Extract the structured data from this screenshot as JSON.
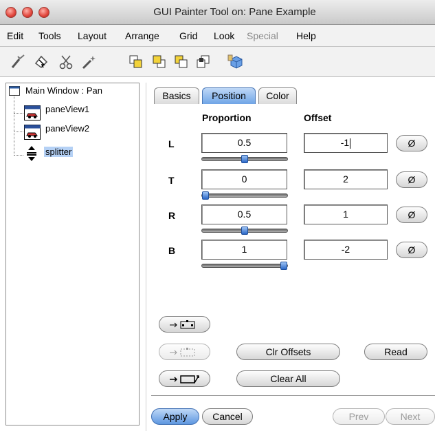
{
  "window": {
    "title": "GUI Painter Tool on: Pane Example"
  },
  "menubar": {
    "items": [
      {
        "label": "Edit",
        "enabled": true
      },
      {
        "label": "Tools",
        "enabled": true
      },
      {
        "label": "Layout",
        "enabled": true
      },
      {
        "label": "Arrange",
        "enabled": true
      },
      {
        "label": "Grid",
        "enabled": true
      },
      {
        "label": "Look",
        "enabled": true
      },
      {
        "label": "Special",
        "enabled": false
      },
      {
        "label": "Help",
        "enabled": true
      }
    ]
  },
  "toolbar": {
    "icons": [
      "wand-check-icon",
      "select-arrow-icon",
      "scissors-icon",
      "wand-icon",
      "bring-to-front-icon",
      "send-to-back-icon",
      "bring-forward-icon",
      "send-backward-icon",
      "cube-paint-icon"
    ]
  },
  "tree": {
    "root": "Main Window : Pan",
    "children": [
      {
        "label": "paneView1",
        "icon": "pane-view-icon"
      },
      {
        "label": "paneView2",
        "icon": "pane-view-icon"
      },
      {
        "label": "splitter",
        "icon": "splitter-icon",
        "selected": true
      }
    ]
  },
  "tabs": [
    {
      "label": "Basics",
      "active": false
    },
    {
      "label": "Position",
      "active": true
    },
    {
      "label": "Color",
      "active": false
    }
  ],
  "position": {
    "proportion_header": "Proportion",
    "offset_header": "Offset",
    "rows": [
      {
        "label": "L",
        "proportion": "0.5",
        "offset": "-1",
        "slider_fraction": 0.5,
        "zero_label": "Ø"
      },
      {
        "label": "T",
        "proportion": "0",
        "offset": "2",
        "slider_fraction": 0.0,
        "zero_label": "Ø"
      },
      {
        "label": "R",
        "proportion": "0.5",
        "offset": "1",
        "slider_fraction": 0.5,
        "zero_label": "Ø"
      },
      {
        "label": "B",
        "proportion": "1",
        "offset": "-2",
        "slider_fraction": 1.0,
        "zero_label": "Ø"
      }
    ],
    "clear_offsets_label": "Clr Offsets",
    "read_label": "Read",
    "clear_all_label": "Clear All"
  },
  "footer": {
    "apply_label": "Apply",
    "cancel_label": "Cancel",
    "prev_label": "Prev",
    "next_label": "Next"
  },
  "colors": {
    "accent_blue": "#5e97e0",
    "selection": "#b5d1f5",
    "close_red": "#e0443a"
  }
}
